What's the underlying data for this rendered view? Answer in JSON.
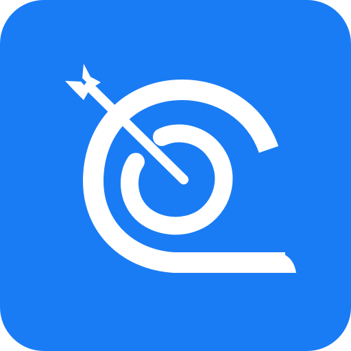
{
  "icon": {
    "name": "target-spiral-arrow",
    "background_color": "#1A7CF5",
    "foreground_color": "#FFFFFF"
  }
}
